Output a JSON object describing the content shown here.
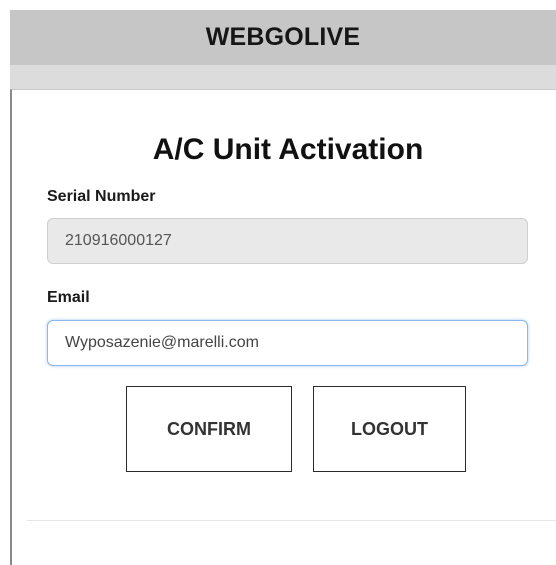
{
  "header": {
    "title": "WEBGOLIVE"
  },
  "form": {
    "title": "A/C Unit Activation",
    "serial_label": "Serial Number",
    "serial_value": "210916000127",
    "email_label": "Email",
    "email_value": "Wyposazenie@marelli.com"
  },
  "actions": {
    "confirm_label": "CONFIRM",
    "logout_label": "LOGOUT"
  },
  "colors": {
    "header_bg": "#c6c6c6",
    "focus_border": "#8ab8ea",
    "disabled_input_bg": "#e9e9e9"
  }
}
